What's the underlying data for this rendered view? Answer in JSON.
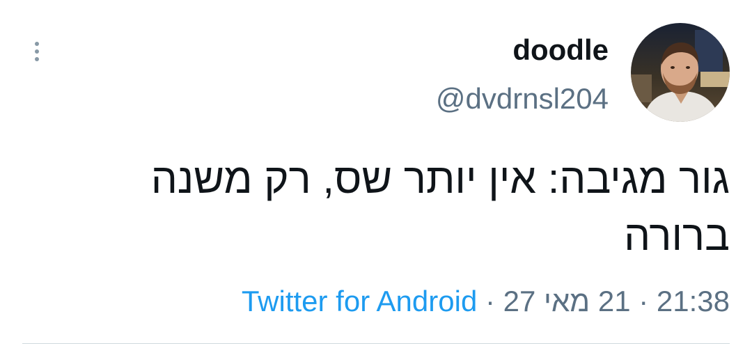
{
  "author": {
    "display_name": "doodle",
    "handle": "@dvdrnsl204"
  },
  "tweet": {
    "text": "גור מגיבה: אין יותר שס, רק משנה ברורה"
  },
  "meta": {
    "source": "Twitter for Android",
    "separator": " · ",
    "date": "21 מאי 27",
    "time": "21:38"
  },
  "icons": {
    "more": "more-vertical-icon"
  },
  "colors": {
    "text": "#0f1419",
    "secondary": "#5b7083",
    "link": "#1d9bf0",
    "divider": "#cfd9de"
  }
}
